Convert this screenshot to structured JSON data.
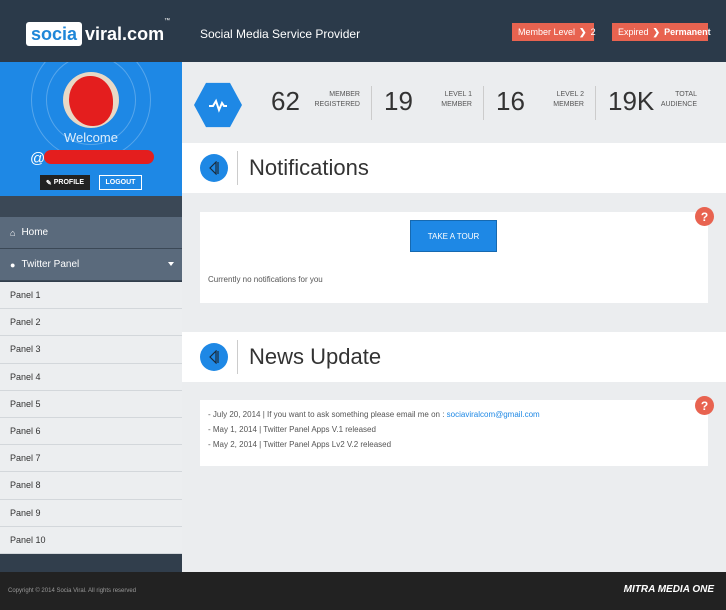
{
  "header": {
    "logo_left": "socia",
    "logo_right": "viral.com",
    "logo_tm": "™",
    "tagline": "Social Media Service Provider",
    "member_level_label": "Member Level",
    "member_level_value": "2",
    "expired_label": "Expired",
    "expired_value": "Permanent",
    "accent_color": "#e86350"
  },
  "profile": {
    "welcome": "Welcome",
    "handle_prefix": "@",
    "profile_button": "PROFILE",
    "logout_button": "LOGOUT",
    "background_color": "#1e88e5"
  },
  "sidebar": {
    "home": "Home",
    "twitter_panel": "Twitter Panel",
    "panels": [
      "Panel 1",
      "Panel 2",
      "Panel 3",
      "Panel 4",
      "Panel 5",
      "Panel 6",
      "Panel 7",
      "Panel 8",
      "Panel 9",
      "Panel 10"
    ]
  },
  "stats": [
    {
      "value": "62",
      "label_line1": "MEMBER",
      "label_line2": "REGISTERED"
    },
    {
      "value": "19",
      "label_line1": "LEVEL 1",
      "label_line2": "MEMBER"
    },
    {
      "value": "16",
      "label_line1": "LEVEL 2",
      "label_line2": "MEMBER"
    },
    {
      "value": "19K",
      "label_line1": "TOTAL",
      "label_line2": "AUDIENCE"
    }
  ],
  "notifications": {
    "title": "Notifications",
    "tour_button": "TAKE A TOUR",
    "empty_text": "Currently no notifications for you"
  },
  "news": {
    "title": "News Update",
    "line1_text": "- July 20, 2014 | If you want to ask something please email me on : ",
    "line1_email": "sociaviralcom@gmail.com",
    "line2": "- May 1, 2014 | Twitter Panel Apps V.1 released",
    "line3": "- May 2, 2014 | Twitter Panel Apps Lv2 V.2 released"
  },
  "footer": {
    "copyright": "Copyright © 2014 Socia Viral. All rights reserved",
    "brand": "MITRA MEDIA ONE"
  },
  "help_glyph": "?"
}
